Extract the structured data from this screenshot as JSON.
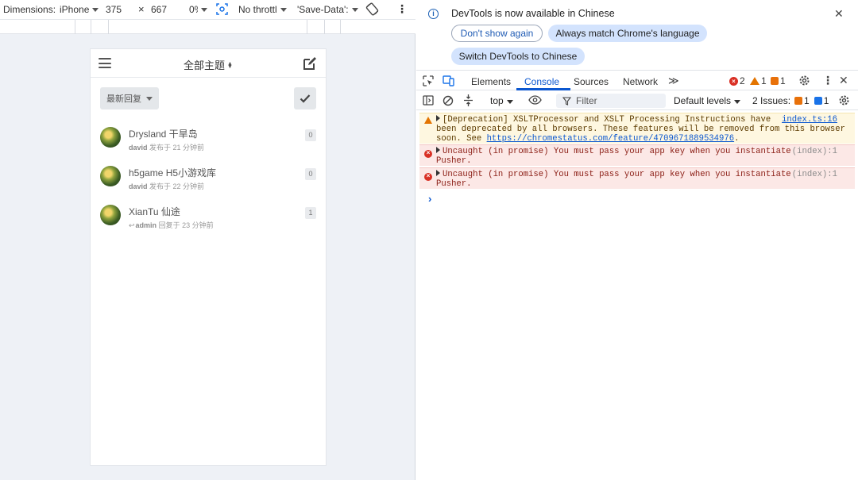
{
  "device_toolbar": {
    "dimensions_label": "Dimensions:",
    "device": "iPhone",
    "width": "375",
    "times": "×",
    "height": "667",
    "zoom": "0%",
    "throttle": "No throttl",
    "save_data": "'Save-Data':",
    "more": "⋮"
  },
  "phone": {
    "title": "全部主题",
    "sort_icon": "◆",
    "sort_label": "最新回复",
    "topics": [
      {
        "title": "Drysland 干旱岛",
        "user": "david",
        "meta": " 发布于 21 分钟前",
        "count": "0",
        "reply": false
      },
      {
        "title": "h5game H5小游戏库",
        "user": "david",
        "meta": " 发布于 22 分钟前",
        "count": "0",
        "reply": false
      },
      {
        "title": "XianTu 仙途",
        "user": "admin",
        "meta": " 回复于 23 分钟前",
        "count": "1",
        "reply": true
      }
    ]
  },
  "infobar": {
    "message": "DevTools is now available in Chinese",
    "dont_show": "Don't show again",
    "always_match": "Always match Chrome's language",
    "switch": "Switch DevTools to Chinese",
    "close": "✕"
  },
  "tabs": {
    "elements": "Elements",
    "console": "Console",
    "sources": "Sources",
    "network": "Network",
    "more": "≫",
    "errors": "2",
    "warnings": "1",
    "issues": "1"
  },
  "console_toolbar": {
    "context": "top",
    "filter_placeholder": "Filter",
    "levels": "Default levels",
    "issues_label": "2 Issues:",
    "issues_orange": "1",
    "issues_blue": "1"
  },
  "messages": {
    "warn_line1": "[Deprecation] XSLTProcessor and XSLT Processing Instructions have",
    "warn_line2": "been deprecated by all browsers. These features will be removed from this browser",
    "warn_line3_pre": "soon. See ",
    "warn_link": "https://chromestatus.com/feature/4709671889534976",
    "warn_line3_post": ".",
    "warn_source": "index.ts:16",
    "err_line1": "Uncaught (in promise) You must pass your app key when you instantiate",
    "err_line2": "Pusher.",
    "err_source": "(index):1",
    "prompt": "›"
  },
  "colors": {
    "accent": "#0b57d0",
    "error": "#d93025",
    "warning": "#e37400"
  }
}
